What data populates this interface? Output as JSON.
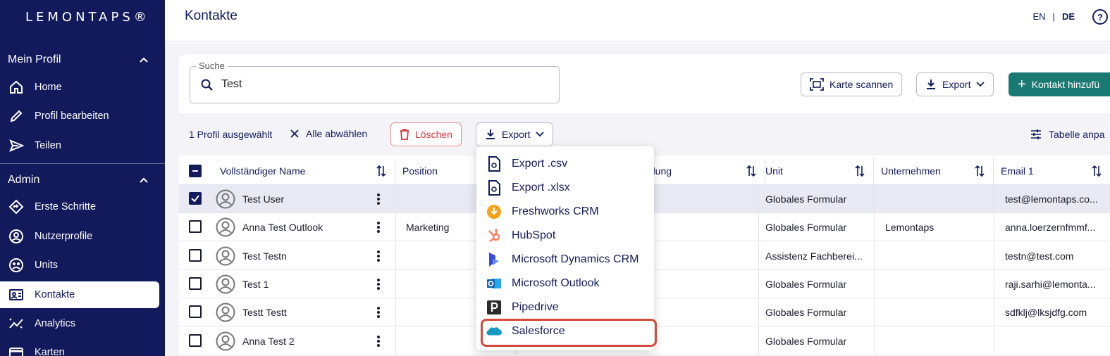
{
  "brand": {
    "logo": "LEMONTAPS®"
  },
  "sidebar": {
    "sections": [
      {
        "label": "Mein Profil"
      },
      {
        "label": "Admin"
      }
    ],
    "items": [
      {
        "label": "Home",
        "icon": "home-icon"
      },
      {
        "label": "Profil bearbeiten",
        "icon": "pencil-icon"
      },
      {
        "label": "Teilen",
        "icon": "send-icon"
      },
      {
        "label": "Erste Schritte",
        "icon": "route-icon"
      },
      {
        "label": "Nutzerprofile",
        "icon": "user-circle-icon"
      },
      {
        "label": "Units",
        "icon": "units-icon"
      },
      {
        "label": "Kontakte",
        "icon": "contacts-icon",
        "active": true
      },
      {
        "label": "Analytics",
        "icon": "analytics-icon"
      },
      {
        "label": "Karten",
        "icon": "card-icon"
      }
    ]
  },
  "header": {
    "title": "Kontakte",
    "lang_en": "EN",
    "lang_sep": "|",
    "lang_de": "DE",
    "help": "?"
  },
  "search": {
    "label": "Suche",
    "value": "Test"
  },
  "actions": {
    "scan": "Karte scannen",
    "export": "Export",
    "add": "Kontakt hinzufü"
  },
  "selection": {
    "count_text": "1 Profil ausgewählt",
    "deselect": "Alle abwählen",
    "delete": "Löschen",
    "export": "Export",
    "table_adjust": "Tabelle anpa"
  },
  "table": {
    "columns": [
      "Vollständiger Name",
      "Position",
      "bteilung",
      "Unit",
      "Unternehmen",
      "Email 1"
    ],
    "rows": [
      {
        "name": "Test User",
        "position": "",
        "unit": "Globales Formular",
        "company": "",
        "email": "test@lemontaps.co...",
        "checked": true
      },
      {
        "name": "Anna Test Outlook",
        "position": "Marketing",
        "unit": "Globales Formular",
        "company": "Lemontaps",
        "email": "anna.loerzernfmmf...",
        "checked": false
      },
      {
        "name": "Test Testn",
        "position": "",
        "unit": "Assistenz Fachberei...",
        "company": "",
        "email": "testn@test.com",
        "checked": false
      },
      {
        "name": "Test 1",
        "position": "",
        "unit": "Globales Formular",
        "company": "",
        "email": "raji.sarhi@lemonta...",
        "checked": false
      },
      {
        "name": "Testt Testt",
        "position": "",
        "unit": "Globales Formular",
        "company": "",
        "email": "sdfklj@lksjdfg.com",
        "checked": false
      },
      {
        "name": "Anna Test 2",
        "position": "",
        "unit": "Globales Formular",
        "company": "",
        "email": "",
        "checked": false
      }
    ]
  },
  "export_menu": {
    "items": [
      {
        "label": "Export .csv",
        "icon": "file-csv-icon"
      },
      {
        "label": "Export .xlsx",
        "icon": "file-xlsx-icon"
      },
      {
        "label": "Freshworks CRM",
        "icon": "freshworks-icon"
      },
      {
        "label": "HubSpot",
        "icon": "hubspot-icon"
      },
      {
        "label": "Microsoft Dynamics CRM",
        "icon": "dynamics-icon"
      },
      {
        "label": "Microsoft Outlook",
        "icon": "outlook-icon"
      },
      {
        "label": "Pipedrive",
        "icon": "pipedrive-icon"
      },
      {
        "label": "Salesforce",
        "icon": "salesforce-icon",
        "highlighted": true
      }
    ]
  },
  "colors": {
    "sidebar": "#131a5c",
    "primary": "#1a7a73",
    "danger": "#d9363e",
    "highlight": "#d24b3c"
  }
}
